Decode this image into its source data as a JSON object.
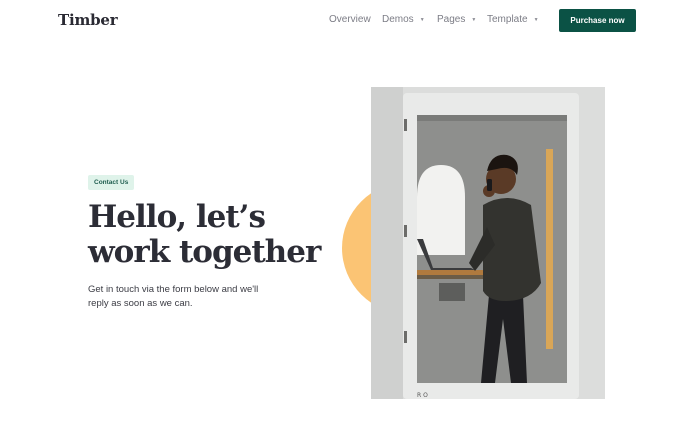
{
  "nav": {
    "logo": "Timber",
    "items": [
      {
        "label": "Overview",
        "dropdown": false
      },
      {
        "label": "Demos",
        "dropdown": true
      },
      {
        "label": "Pages",
        "dropdown": true
      },
      {
        "label": "Template",
        "dropdown": true
      }
    ],
    "cta_label": "Purchase now"
  },
  "hero": {
    "badge": "Contact Us",
    "headline_line1": "Hello, let’s",
    "headline_line2": "work together",
    "sub_line1": "Get in touch via the form below and we'll",
    "sub_line2": "reply as soon as we can."
  },
  "photo": {
    "door_letters": "R O"
  },
  "colors": {
    "brand_green": "#0b5245",
    "badge_bg": "#dff3ea",
    "accent_circle": "#fbc474",
    "heading": "#2c2d36"
  },
  "icons": {
    "caret": "chevron-down-icon"
  }
}
